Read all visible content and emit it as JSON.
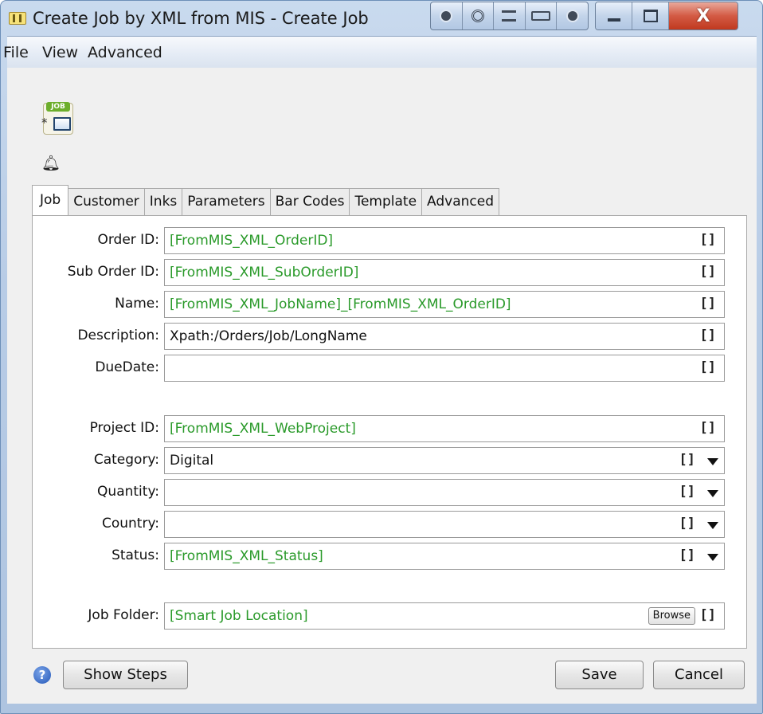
{
  "window": {
    "title": "Create Job by XML from MIS - Create Job",
    "close_glyph": "X"
  },
  "menu": [
    "File",
    "View",
    "Advanced"
  ],
  "job_icon": {
    "tag": "JOB",
    "modified_mark": "*"
  },
  "tabs": [
    "Job",
    "Customer",
    "Inks",
    "Parameters",
    "Bar Codes",
    "Template",
    "Advanced"
  ],
  "active_tab": "Job",
  "bracket_glyph": "[]",
  "fields": {
    "order_id": {
      "label": "Order ID:",
      "value": "[FromMIS_XML_OrderID]"
    },
    "sub_order_id": {
      "label": "Sub Order ID:",
      "value": "[FromMIS_XML_SubOrderID]"
    },
    "name": {
      "label": "Name:",
      "value": "[FromMIS_XML_JobName]_[FromMIS_XML_OrderID]"
    },
    "description": {
      "label": "Description:",
      "value": "Xpath:/Orders/Job/LongName"
    },
    "due_date": {
      "label": "DueDate:",
      "value": ""
    },
    "project_id": {
      "label": "Project ID:",
      "value": "[FromMIS_XML_WebProject]"
    },
    "category": {
      "label": "Category:",
      "value": "Digital"
    },
    "quantity": {
      "label": "Quantity:",
      "value": ""
    },
    "country": {
      "label": "Country:",
      "value": ""
    },
    "status": {
      "label": "Status:",
      "value": "[FromMIS_XML_Status]"
    },
    "job_folder": {
      "label": "Job Folder:",
      "value": "[Smart Job Location]",
      "browse_label": "Browse"
    }
  },
  "buttons": {
    "help": "?",
    "show_steps": "Show Steps",
    "save": "Save",
    "cancel": "Cancel"
  },
  "colors": {
    "variable_text": "#2a9a2a",
    "title_bar": "#b8cce6",
    "close_button": "#c0391f"
  }
}
